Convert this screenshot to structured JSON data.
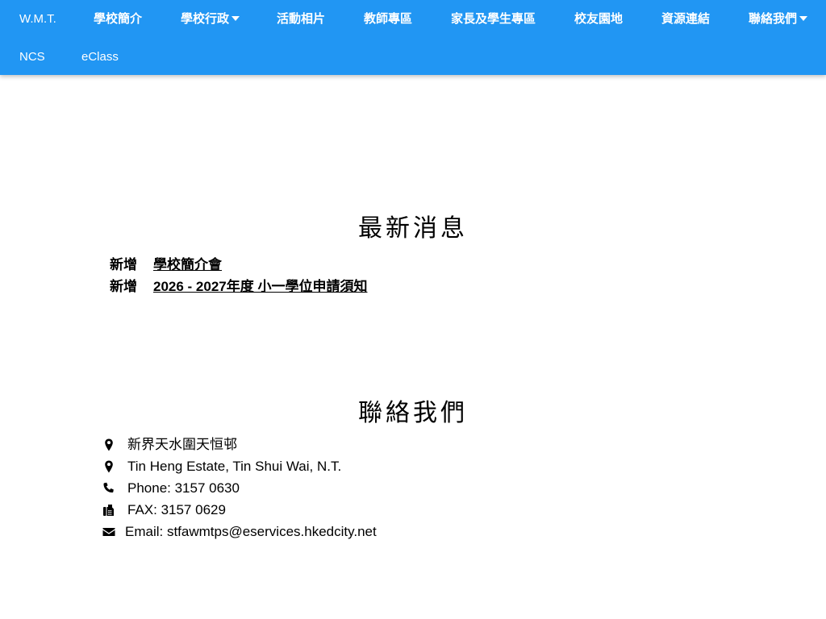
{
  "nav": {
    "items": [
      {
        "label": "W.M.T."
      },
      {
        "label": "學校簡介"
      },
      {
        "label": "學校行政"
      },
      {
        "label": "活動相片"
      },
      {
        "label": "教師專區"
      },
      {
        "label": "家長及學生專區"
      },
      {
        "label": "校友園地"
      },
      {
        "label": "資源連結"
      },
      {
        "label": "聯絡我們"
      },
      {
        "label": "NCS"
      },
      {
        "label": "eClass"
      }
    ],
    "color": "#2196f3"
  },
  "news": {
    "title": "最新消息",
    "items": [
      {
        "tag": "新增",
        "label": "學校簡介會"
      },
      {
        "tag": "新增",
        "label": "2026 - 2027年度 小一學位申請須知"
      }
    ]
  },
  "contact": {
    "title": "聯絡我們",
    "items": [
      {
        "icon": "map-marker-icon",
        "text": "新界天水圍天恒邨"
      },
      {
        "icon": "map-marker-icon",
        "text": "Tin Heng Estate, Tin Shui Wai, N.T."
      },
      {
        "icon": "phone-icon",
        "text": "Phone: 3157 0630"
      },
      {
        "icon": "fax-icon",
        "text": "FAX: 3157 0629"
      },
      {
        "icon": "envelope-icon",
        "text": "Email: stfawmtps@eservices.hkedcity.net"
      }
    ]
  }
}
